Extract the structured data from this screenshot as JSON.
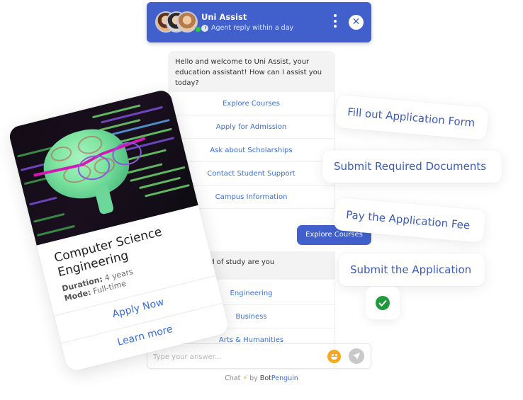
{
  "header": {
    "title": "Uni Assist",
    "subtitle": "Agent reply within a day",
    "status_color": "#2ecc40",
    "brand_color": "#4160cc",
    "avatars": [
      "agent-1",
      "agent-2",
      "agent-3"
    ]
  },
  "chat": {
    "welcome_message": "Hello and welcome to Uni Assist, your education assistant! How can I assist you today?",
    "options": [
      {
        "label": "Explore Courses"
      },
      {
        "label": "Apply for Admission"
      },
      {
        "label": "Ask about Scholarships"
      },
      {
        "label": "Contact Student Support"
      },
      {
        "label": "Campus Information"
      }
    ],
    "user_reply": "Explore Courses",
    "followup_message": "Which field of study are you",
    "followup_options": [
      {
        "label": "Engineering"
      },
      {
        "label": "Business"
      },
      {
        "label": "Arts & Humanities"
      }
    ]
  },
  "input": {
    "placeholder": "Type your answer...",
    "value": "",
    "emoji_icon": "smiley-icon",
    "send_icon": "send-icon"
  },
  "footer": {
    "prefix": "Chat",
    "bolt": "⚡",
    "by": "by",
    "brand_part1": "Bot",
    "brand_part2": "Penguin"
  },
  "course_card": {
    "title": "Computer Science Engineering",
    "duration_label": "Duration:",
    "duration_value": "4 years",
    "mode_label": "Mode:",
    "mode_value": "Full-time",
    "apply_label": "Apply Now",
    "learn_label": "Learn more",
    "image": "brain-with-glasses-code-background"
  },
  "steps": [
    {
      "label": "Fill out Application Form"
    },
    {
      "label": "Submit Required Documents"
    },
    {
      "label": "Pay the Application Fee"
    },
    {
      "label": "Submit the Application"
    }
  ],
  "completion": {
    "icon": "check-circle-icon",
    "color": "#1f9a3a"
  }
}
